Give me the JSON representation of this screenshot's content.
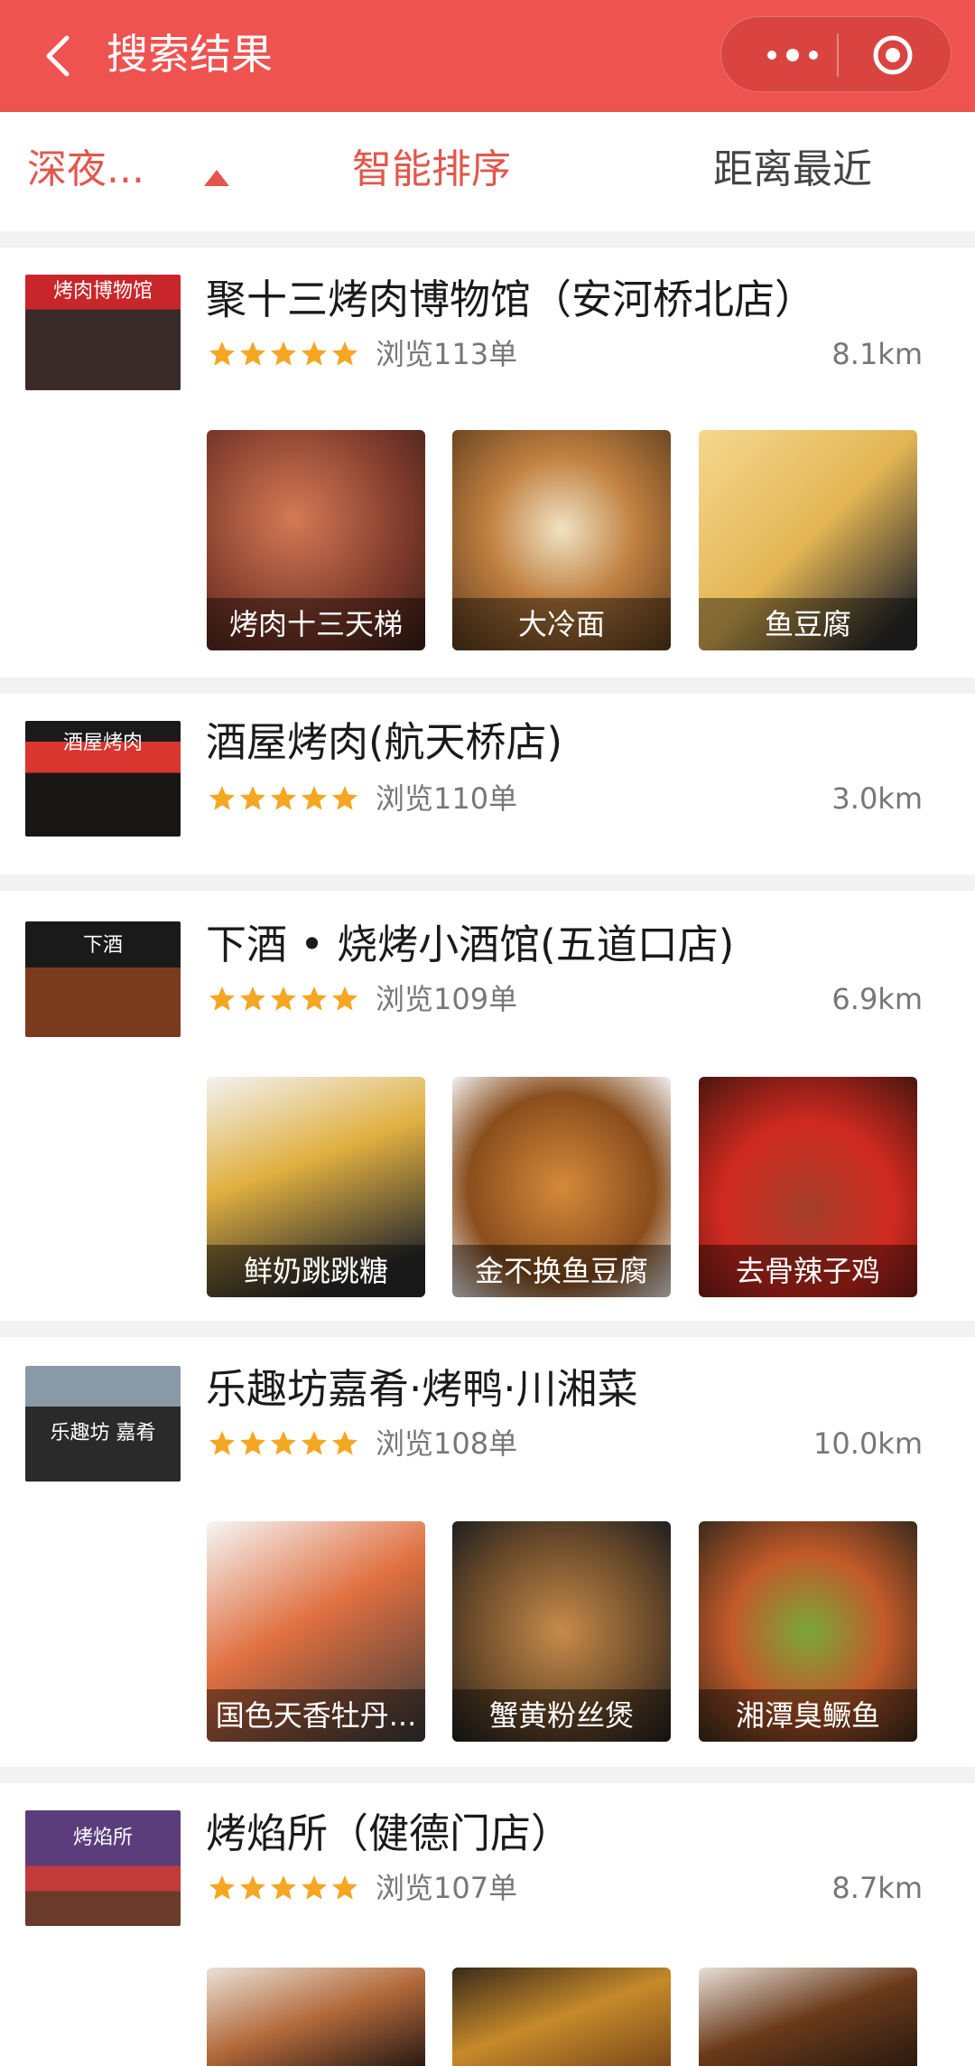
{
  "header": {
    "title": "搜索结果"
  },
  "filters": {
    "category": "深夜...",
    "sort": "智能排序",
    "distance": "距离最近"
  },
  "colors": {
    "accent": "#ef5350",
    "star": "#f5a623",
    "active_filter": "#e2574c"
  },
  "shops": [
    {
      "name": "聚十三烤肉博物馆（安河桥北店）",
      "views": "浏览113单",
      "distance": "8.1km",
      "sign": "烤肉博物馆",
      "dishes": [
        "烤肉十三天梯",
        "大冷面",
        "鱼豆腐"
      ]
    },
    {
      "name": "酒屋烤肉(航天桥店)",
      "views": "浏览110单",
      "distance": "3.0km",
      "sign": "酒屋烤肉",
      "dishes": []
    },
    {
      "name": "下酒 • 烧烤小酒馆(五道口店)",
      "views": "浏览109单",
      "distance": "6.9km",
      "sign": "下酒",
      "dishes": [
        "鲜奶跳跳糖",
        "金不换鱼豆腐",
        "去骨辣子鸡"
      ]
    },
    {
      "name": "乐趣坊嘉肴·烤鸭·川湘菜",
      "views": "浏览108单",
      "distance": "10.0km",
      "sign": "乐趣坊 嘉肴",
      "dishes": [
        "国色天香牡丹...",
        "蟹黄粉丝煲",
        "湘潭臭鳜鱼"
      ]
    },
    {
      "name": "烤焰所（健德门店）",
      "views": "浏览107单",
      "distance": "8.7km",
      "sign": "烤焰所",
      "dishes": [
        "",
        "",
        ""
      ]
    }
  ]
}
